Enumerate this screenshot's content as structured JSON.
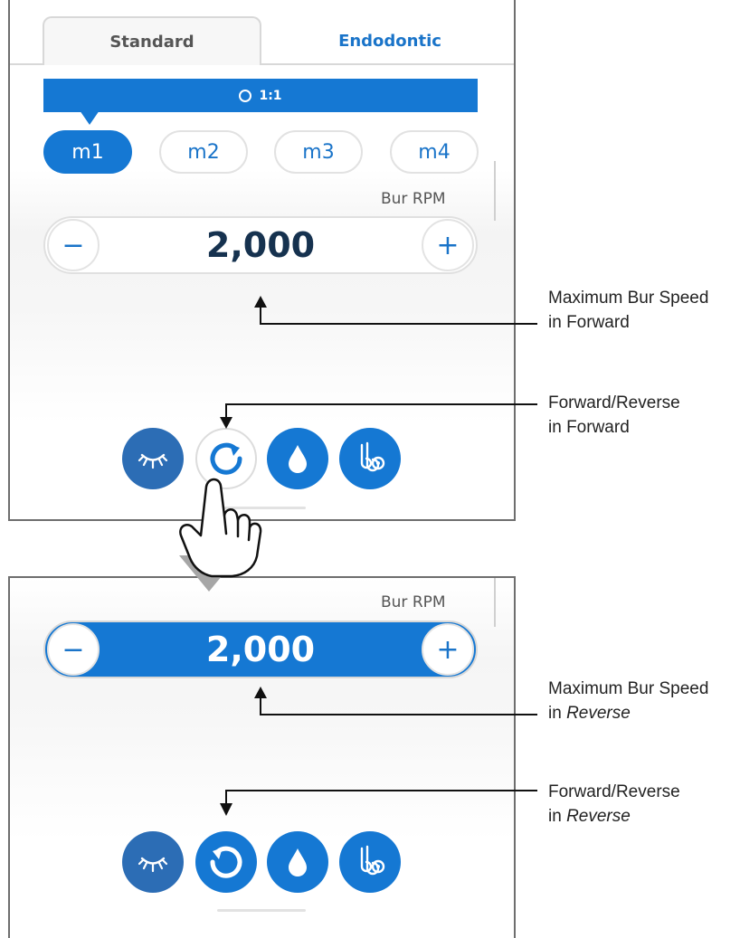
{
  "tabs": [
    {
      "label": "Standard",
      "active": true
    },
    {
      "label": "Endodontic",
      "active": false
    }
  ],
  "ratio": {
    "label": "1:1"
  },
  "modes": [
    {
      "label": "m1",
      "selected": true
    },
    {
      "label": "m2",
      "selected": false
    },
    {
      "label": "m3",
      "selected": false
    },
    {
      "label": "m4",
      "selected": false
    }
  ],
  "forward_view": {
    "speed_label": "Bur RPM",
    "speed_value": "2,000",
    "minus": "−",
    "plus": "+"
  },
  "reverse_view": {
    "speed_label": "Bur RPM",
    "speed_value": "2,000",
    "minus": "−",
    "plus": "+"
  },
  "control_icons": [
    "light-icon",
    "rotation-direction-icon",
    "water-drop-icon",
    "air-spray-icon"
  ],
  "annotations": {
    "max_speed_forward": {
      "line1": "Maximum Bur Speed",
      "line2_prefix": "in ",
      "line2_term": "Forward"
    },
    "direction_forward": {
      "line1": "Forward/Reverse",
      "line2_prefix": "in ",
      "line2_term": "Forward"
    },
    "max_speed_reverse": {
      "line1": "Maximum Bur Speed",
      "line2_prefix": "in ",
      "line2_term": "Reverse"
    },
    "direction_reverse": {
      "line1": "Forward/Reverse",
      "line2_prefix": "in ",
      "line2_term": "Reverse"
    }
  },
  "colors": {
    "accent": "#1578d3",
    "dark_button": "#2c6db5",
    "value_text": "#16324f",
    "transition_arrow": "#a6a6a6"
  }
}
